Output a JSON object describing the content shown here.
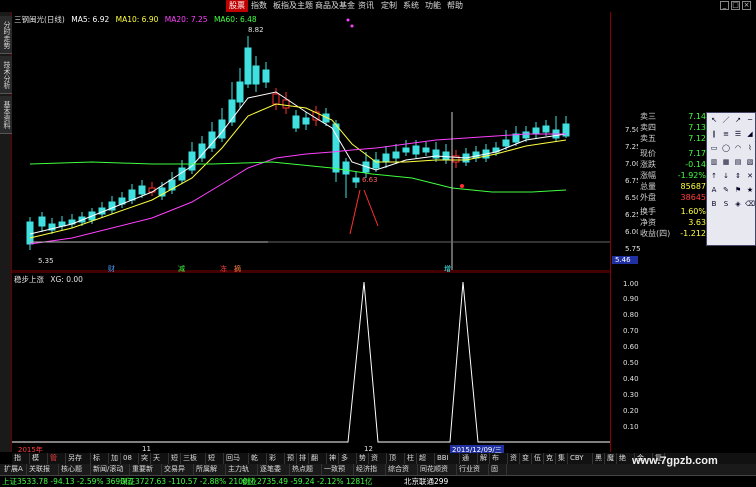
{
  "menu": {
    "items": [
      "股票",
      "指数",
      "板指及主题",
      "商品及基金",
      "资讯",
      "定制",
      "系统",
      "功能",
      "帮助"
    ],
    "active_index": 0
  },
  "left_tabs": [
    "分时走势",
    "技术分析",
    "基本资料"
  ],
  "main_chart": {
    "title": "三钢闽光(日线)",
    "ma5_label": "MA5: 6.92",
    "ma10_label": "MA10: 6.90",
    "ma20_label": "MA20: 7.25",
    "ma60_label": "MA60: 6.48",
    "peak_label": "8.82",
    "low_label": "5.35",
    "mid_label": "6.63",
    "markers": [
      "财",
      "减",
      "冻",
      "摘",
      "增"
    ]
  },
  "sub_chart": {
    "title": "稳步上涨",
    "value_label": "XG: 0.00"
  },
  "right_axis": {
    "main_ticks": [
      "7.50",
      "7.25",
      "7.00",
      "6.75",
      "6.50",
      "6.25",
      "6.00",
      "5.75"
    ],
    "current_price": "5.46",
    "sub_ticks": [
      "1.00",
      "0.90",
      "0.80",
      "0.70",
      "0.60",
      "0.50",
      "0.40",
      "0.30",
      "0.20",
      "0.10"
    ]
  },
  "quote": {
    "rows": [
      {
        "label": "卖三",
        "value": "7.14"
      },
      {
        "label": "卖四",
        "value": "7.13"
      },
      {
        "label": "卖五",
        "value": "7.12"
      },
      {
        "label": "现价",
        "value": "7.17"
      },
      {
        "label": "涨跌",
        "value": "-0.14"
      },
      {
        "label": "涨幅",
        "value": "-1.92%"
      },
      {
        "label": "总量",
        "value": "85687"
      },
      {
        "label": "外盘",
        "value": "38645"
      },
      {
        "label": "换手",
        "value": "1.60%"
      },
      {
        "label": "净资",
        "value": "3.63"
      },
      {
        "label": "收益(四)",
        "value": "-1.212"
      }
    ]
  },
  "date_bar": {
    "left": "2015年",
    "mid1": "11",
    "mid2": "12",
    "cursor": "2015/12/09/三"
  },
  "bottom_tabs": [
    "指标",
    "模板",
    "管理",
    "另存为",
    "标准",
    "加",
    "08",
    "突",
    "天天",
    "短",
    "三板斧",
    "短线",
    "回马枪",
    "乾坤",
    "彩线",
    "预",
    "排",
    "翻黑",
    "神",
    "多空",
    "势",
    "资线",
    "顶底",
    "柱",
    "超短",
    "BBI",
    "通道",
    "解",
    "布林",
    "资",
    "变",
    "伍",
    "克",
    "集",
    "CBY",
    "黑",
    "魔",
    "绝佳",
    "金牛",
    "复"
  ],
  "bottom_tabs_active": 2,
  "second_tabs": [
    "扩展A",
    "关联报价",
    "核心题材",
    "新闻/滚动",
    "重要新闻",
    "交易异动",
    "所属解禁",
    "主力轨迹",
    "逐笔委托",
    "热点题材",
    "一致预期",
    "经济指标",
    "综合资讯",
    "同花顺资讯",
    "行业资讯",
    "固定"
  ],
  "status": {
    "sh": "上证3533.78 -94.13 -2.59% 3690亿",
    "sz": "深证3727.63 -110.57 -2.88% 2100亿",
    "cy": "创业2735.49 -59.24 -2.12% 1281亿",
    "broker": "北京联通299"
  },
  "watermark": "www.7gpzb.com",
  "colors": {
    "up": "#ff3030",
    "down": "#40e0e0",
    "ma5": "#ffffff",
    "ma10": "#ffff40",
    "ma20": "#ff40ff",
    "ma60": "#40ff40"
  }
}
